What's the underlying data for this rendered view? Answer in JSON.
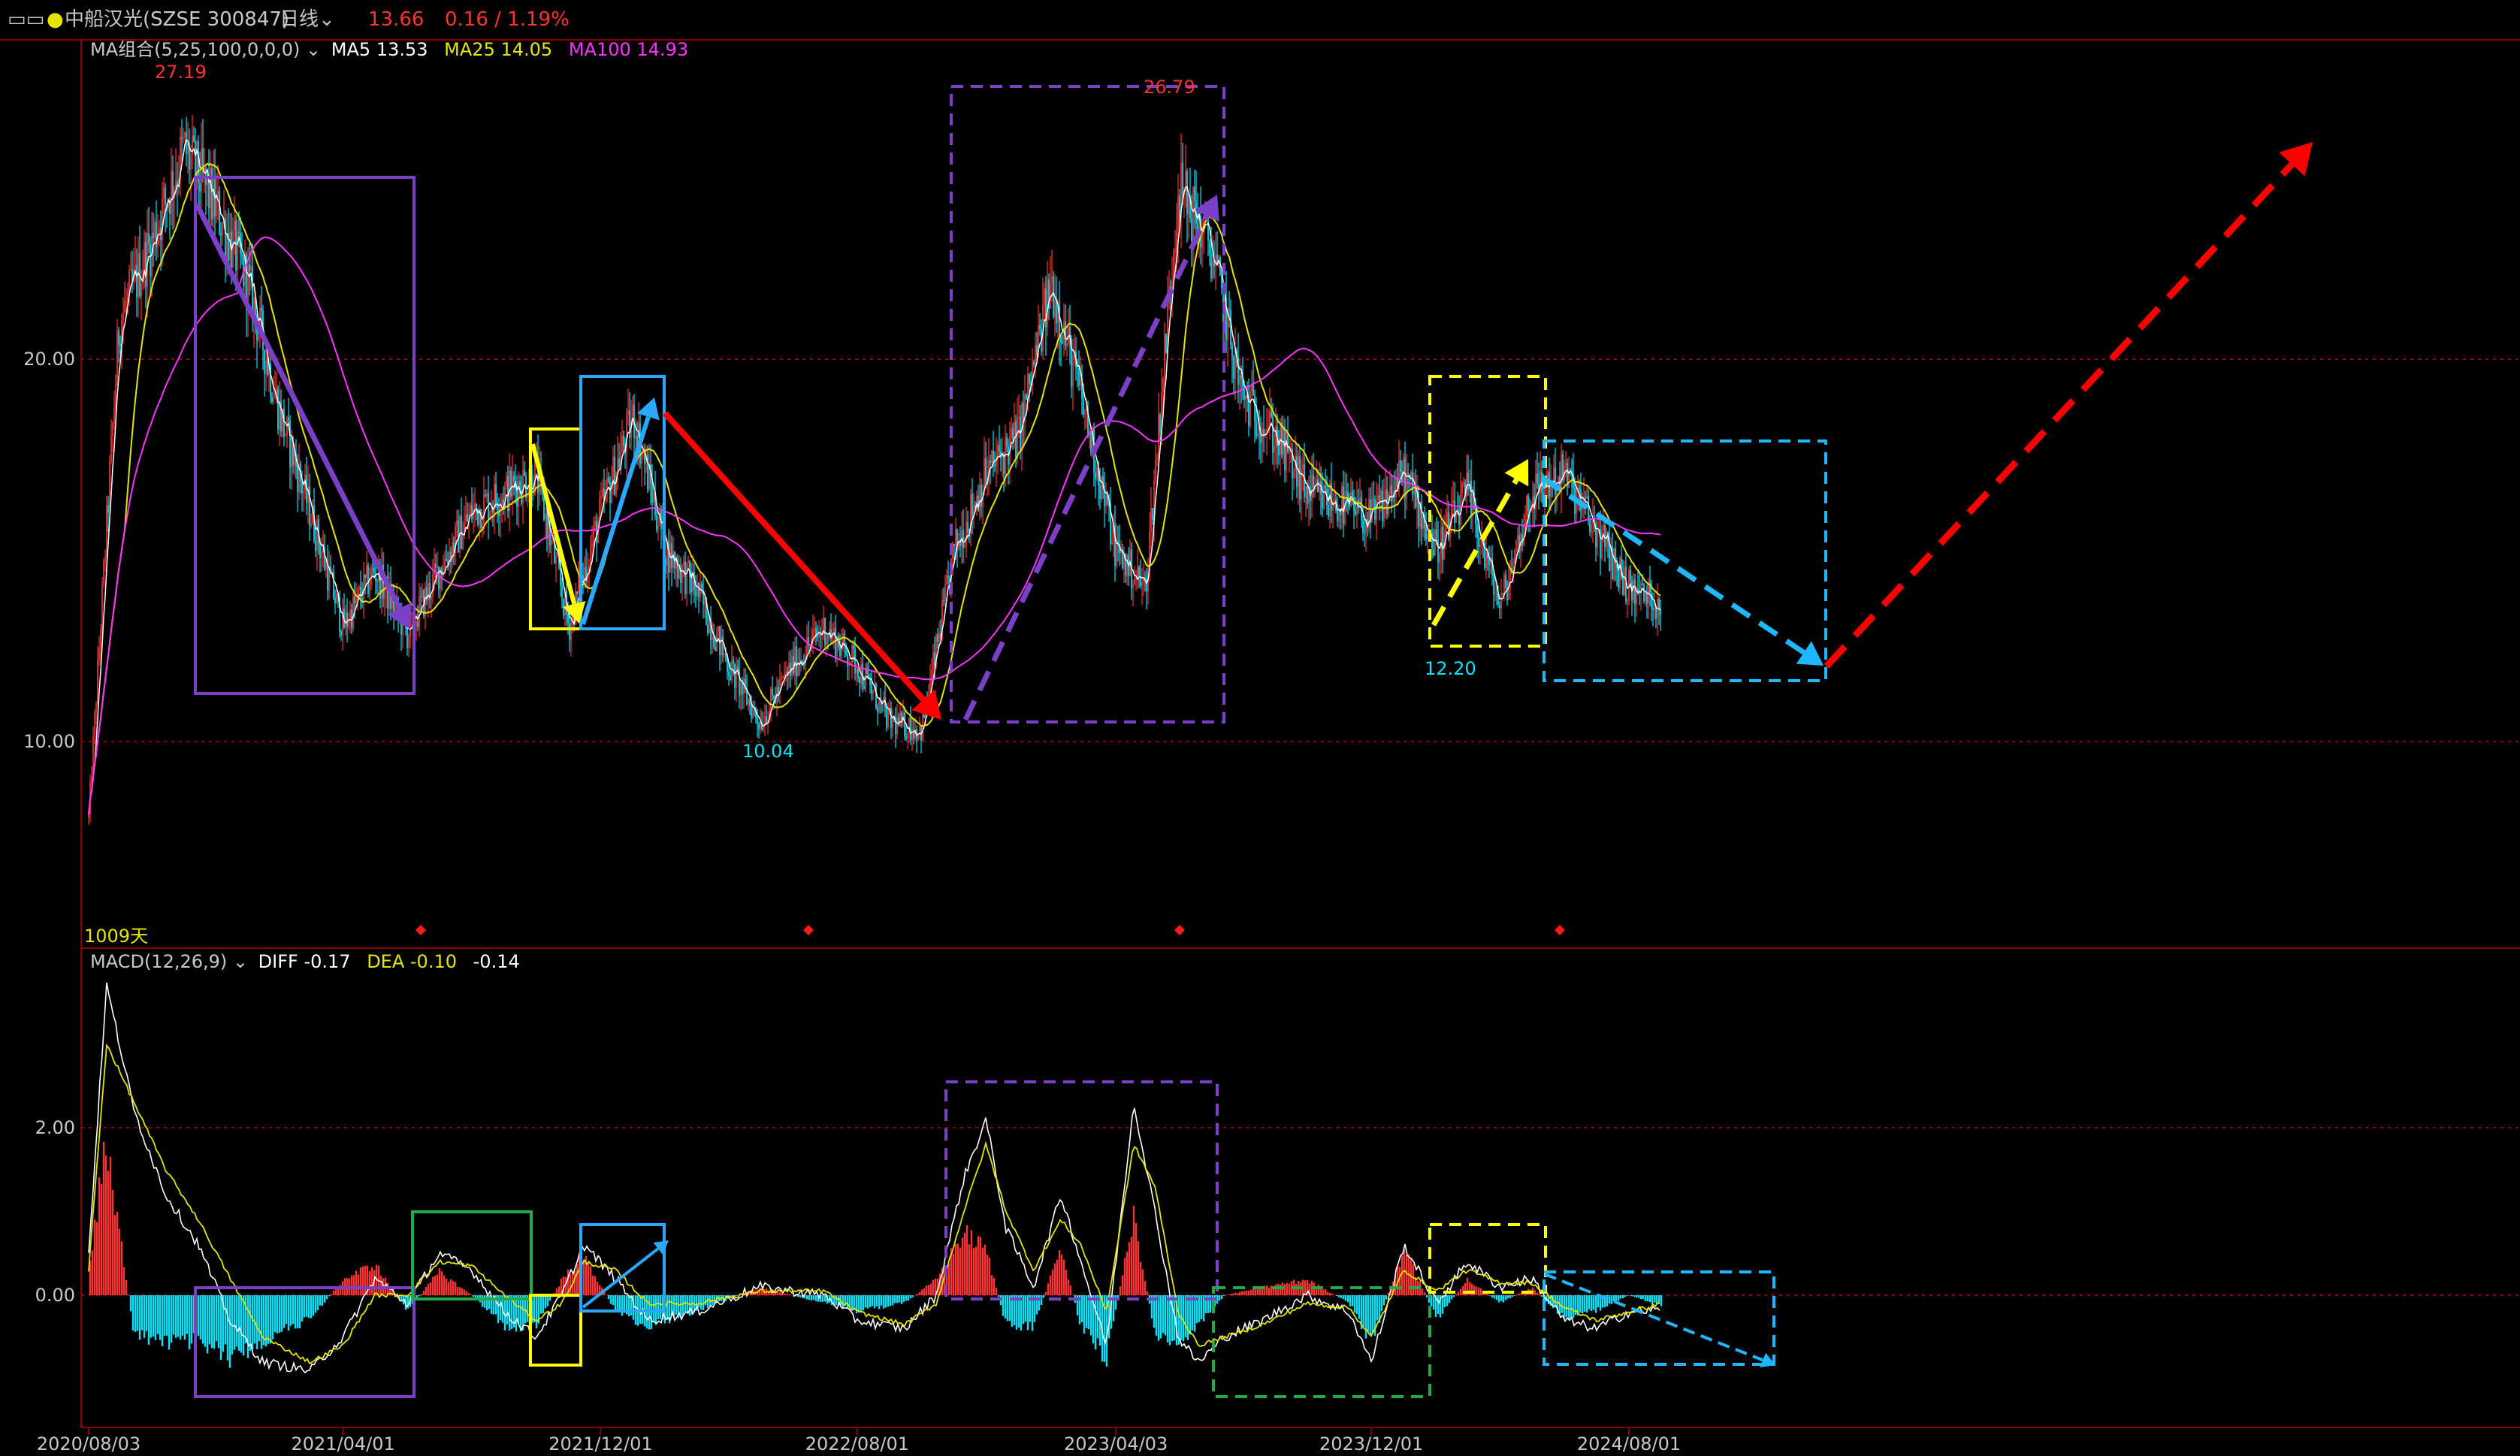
{
  "toolbar": {
    "window_icon": "window-icon",
    "stock_name": "中船汉光(SZSE 300847)",
    "period": "日线",
    "period_icon": "chevron-down-icon",
    "last_price": "13.66",
    "change": "0.16 / 1.19%"
  },
  "colors": {
    "up": "#ff3333",
    "down": "#00e5ff",
    "ma5": "#ffffff",
    "ma25": "#e5e500",
    "ma100": "#ff33ff",
    "dea": "#e5e500",
    "grid": "#8b0000",
    "purple": "#7b3fc8",
    "yellow": "#ffff00",
    "blue": "#2aa8ff",
    "cyan_dash": "#1fb8ff",
    "green": "#22aa44",
    "red_arrow": "#ff0000"
  },
  "price_panel": {
    "indicator_name": "MA组合(5,25,100,0,0,0)",
    "indicator_icon": "chevron-down-icon",
    "ma5_label": "MA5 13.53",
    "ma25_label": "MA25 14.05",
    "ma100_label": "MA100 14.93",
    "day_count": "1009天",
    "high_label": "27.19",
    "high2_label": "26.79",
    "low_label": "10.04",
    "low2_label": "12.20"
  },
  "macd_panel": {
    "indicator_name": "MACD(12,26,9)",
    "indicator_icon": "chevron-down-icon",
    "diff_label": "DIFF -0.17",
    "dea_label": "DEA -0.10",
    "macd_value": "-0.14"
  },
  "chart_data": [
    {
      "type": "candlestick",
      "title": "中船汉光(SZSE 300847) 日线",
      "y_ticks": [
        "20.00",
        "10.00"
      ],
      "ylim": [
        5,
        30
      ],
      "x_ticks": [
        "2020/08/03",
        "2021/04/01",
        "2021/12/01",
        "2022/08/01",
        "2023/04/03",
        "2023/12/01",
        "2024/08/01"
      ],
      "grid": true,
      "anchor_dates": [
        "2020/08/03",
        "2020/09/01",
        "2020/10/01",
        "2020/11/01",
        "2020/12/01",
        "2021/01/01",
        "2021/02/01",
        "2021/03/01",
        "2021/04/01",
        "2021/05/01",
        "2021/06/01",
        "2021/07/01",
        "2021/08/01",
        "2021/09/01",
        "2021/10/01",
        "2021/11/01",
        "2021/12/01",
        "2022/01/01",
        "2022/02/01",
        "2022/03/01",
        "2022/04/01",
        "2022/05/01",
        "2022/06/01",
        "2022/07/01",
        "2022/08/01",
        "2022/09/01",
        "2022/10/01",
        "2022/11/01",
        "2022/12/01",
        "2023/01/01",
        "2023/02/01",
        "2023/03/01",
        "2023/04/03",
        "2023/05/01",
        "2023/06/01",
        "2023/07/01",
        "2023/08/01",
        "2023/09/01",
        "2023/10/01",
        "2023/11/01",
        "2023/12/01",
        "2024/01/01",
        "2024/02/01",
        "2024/03/01",
        "2024/04/01",
        "2024/05/01",
        "2024/06/01",
        "2024/07/01",
        "2024/08/01",
        "2024/09/01"
      ],
      "anchor_prices": [
        8.0,
        21.0,
        23.0,
        25.5,
        24.0,
        22.0,
        18.5,
        16.0,
        13.0,
        14.5,
        12.8,
        14.5,
        16.0,
        16.5,
        17.0,
        13.0,
        16.0,
        18.5,
        15.0,
        14.0,
        12.0,
        10.5,
        12.0,
        13.0,
        12.0,
        10.5,
        10.3,
        15.0,
        17.0,
        18.0,
        22.0,
        19.0,
        15.0,
        14.0,
        24.5,
        23.0,
        19.0,
        18.0,
        16.5,
        16.2,
        15.8,
        17.0,
        15.0,
        16.5,
        13.5,
        16.5,
        17.0,
        15.5,
        14.0,
        13.6
      ],
      "annotations": [
        "27.19",
        "26.79",
        "10.04",
        "12.20",
        "1009天"
      ],
      "ma": {
        "MA5": 13.53,
        "MA25": 14.05,
        "MA100": 14.93
      }
    },
    {
      "type": "bar",
      "title": "MACD(12,26,9)",
      "y_ticks": [
        "2.00",
        "0.00"
      ],
      "ylim": [
        -0.8,
        3.8
      ],
      "anchor_dates": [
        "2020/08/03",
        "2020/08/20",
        "2020/09/15",
        "2020/10/15",
        "2020/11/15",
        "2020/12/15",
        "2021/01/15",
        "2021/03/01",
        "2021/04/01",
        "2021/05/01",
        "2021/06/01",
        "2021/07/01",
        "2021/08/01",
        "2021/09/01",
        "2021/10/01",
        "2021/10/25",
        "2021/11/15",
        "2021/12/15",
        "2022/01/15",
        "2022/03/01",
        "2022/05/01",
        "2022/07/01",
        "2022/08/01",
        "2022/09/15",
        "2022/10/15",
        "2022/11/10",
        "2022/12/01",
        "2022/12/20",
        "2023/01/15",
        "2023/02/10",
        "2023/03/01",
        "2023/03/25",
        "2023/04/20",
        "2023/05/10",
        "2023/06/01",
        "2023/06/20",
        "2023/07/15",
        "2023/08/20",
        "2023/10/01",
        "2023/11/10",
        "2023/12/01",
        "2024/01/01",
        "2024/02/01",
        "2024/03/01",
        "2024/04/01",
        "2024/05/01",
        "2024/06/01",
        "2024/07/01",
        "2024/08/01",
        "2024/09/01"
      ],
      "diff": [
        0.5,
        3.7,
        2.2,
        1.2,
        0.6,
        -0.3,
        -0.8,
        -0.9,
        -0.5,
        0.2,
        -0.1,
        0.5,
        0.3,
        -0.2,
        -0.5,
        0.0,
        0.6,
        0.2,
        -0.3,
        -0.2,
        0.1,
        0.0,
        -0.3,
        -0.4,
        0.0,
        1.4,
        2.1,
        0.8,
        0.1,
        1.2,
        0.4,
        -0.6,
        2.3,
        1.0,
        -0.5,
        -0.8,
        -0.5,
        -0.3,
        0.0,
        -0.2,
        -0.8,
        0.6,
        -0.1,
        0.4,
        0.1,
        0.2,
        -0.3,
        -0.4,
        -0.2,
        -0.17
      ],
      "dea": [
        0.3,
        3.0,
        2.3,
        1.5,
        0.9,
        0.2,
        -0.5,
        -0.8,
        -0.6,
        0.0,
        0.0,
        0.4,
        0.35,
        0.0,
        -0.3,
        -0.1,
        0.4,
        0.3,
        -0.1,
        -0.1,
        0.05,
        0.05,
        -0.2,
        -0.35,
        -0.1,
        1.0,
        1.8,
        1.0,
        0.3,
        0.9,
        0.6,
        -0.2,
        1.8,
        1.3,
        -0.2,
        -0.6,
        -0.5,
        -0.35,
        -0.1,
        -0.15,
        -0.5,
        0.3,
        0.05,
        0.3,
        0.15,
        0.15,
        -0.15,
        -0.3,
        -0.2,
        -0.1
      ],
      "macd": [
        0.3,
        2.0,
        -0.5,
        -0.6,
        -0.6,
        -0.8,
        -0.6,
        -0.3,
        0.2,
        0.4,
        -0.2,
        0.3,
        0.0,
        -0.4,
        -0.4,
        0.2,
        0.5,
        -0.2,
        -0.4,
        -0.2,
        0.1,
        -0.1,
        -0.2,
        -0.1,
        0.2,
        0.8,
        0.6,
        -0.4,
        -0.4,
        0.6,
        -0.4,
        -0.8,
        1.0,
        -0.5,
        -0.6,
        -0.4,
        0.0,
        0.1,
        0.2,
        -0.1,
        -0.6,
        0.6,
        -0.3,
        0.2,
        -0.1,
        0.1,
        -0.3,
        -0.2,
        0.0,
        -0.14
      ]
    }
  ]
}
